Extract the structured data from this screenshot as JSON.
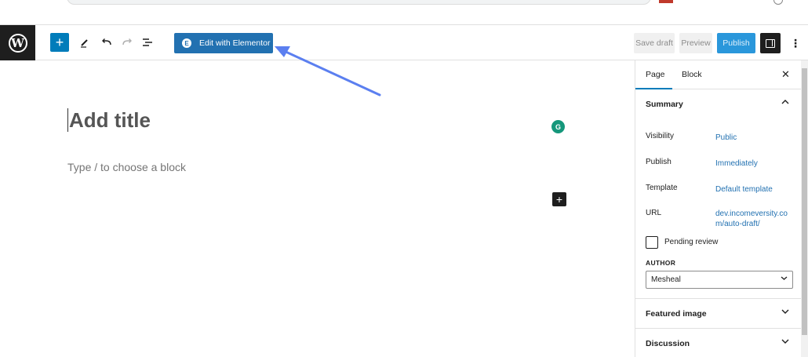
{
  "toolbar": {
    "add_icon": "plus-icon",
    "elementor_label": "Edit with Elementor",
    "elementor_icon_glyph": "E",
    "save_draft_label": "Save draft",
    "preview_label": "Preview",
    "publish_label": "Publish",
    "more_glyph": "⋮"
  },
  "editor": {
    "title_placeholder": "Add title",
    "block_placeholder": "Type / to choose a block",
    "grammarly_glyph": "G",
    "inserter_glyph": "+"
  },
  "sidebar": {
    "tabs": [
      {
        "label": "Page",
        "active": true
      },
      {
        "label": "Block",
        "active": false
      }
    ],
    "close_glyph": "✕",
    "summary": {
      "title": "Summary",
      "rows": [
        {
          "label": "Visibility",
          "value": "Public"
        },
        {
          "label": "Publish",
          "value": "Immediately"
        },
        {
          "label": "Template",
          "value": "Default template"
        },
        {
          "label": "URL",
          "value": "dev.incomeversity.com/auto-draft/"
        }
      ],
      "pending_review_label": "Pending review",
      "author_label": "AUTHOR",
      "author_value": "Mesheal"
    },
    "featured_image_title": "Featured image",
    "discussion_title": "Discussion"
  },
  "colors": {
    "accent": "#007cba",
    "elementor": "#2271b1",
    "publish": "#2a97db",
    "annotation_arrow": "#5b7ff0"
  }
}
